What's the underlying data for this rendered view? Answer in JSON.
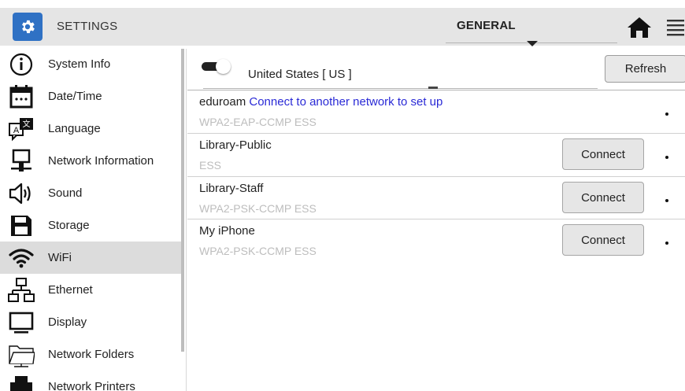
{
  "header": {
    "app_title": "SETTINGS",
    "section": "GENERAL",
    "app_icon": "gear-icon",
    "home_icon": "home-icon",
    "menu_icon": "hamburger-menu-icon",
    "accent_color": "#2f71c4"
  },
  "sidebar": {
    "items": [
      {
        "label": "System Info",
        "icon": "info-icon",
        "active": false
      },
      {
        "label": "Date/Time",
        "icon": "calendar-icon",
        "active": false
      },
      {
        "label": "Language",
        "icon": "language-icon",
        "active": false
      },
      {
        "label": "Network Information",
        "icon": "network-computer-icon",
        "active": false
      },
      {
        "label": "Sound",
        "icon": "speaker-icon",
        "active": false
      },
      {
        "label": "Storage",
        "icon": "floppy-disk-icon",
        "active": false
      },
      {
        "label": "WiFi",
        "icon": "wifi-icon",
        "active": true
      },
      {
        "label": "Ethernet",
        "icon": "ethernet-icon",
        "active": false
      },
      {
        "label": "Display",
        "icon": "monitor-icon",
        "active": false
      },
      {
        "label": "Network Folders",
        "icon": "folder-icon",
        "active": false
      },
      {
        "label": "Network Printers",
        "icon": "printer-icon",
        "active": false
      }
    ]
  },
  "wifi": {
    "enabled": true,
    "country": "United States [ US ]",
    "refresh_label": "Refresh",
    "networks": [
      {
        "name": "eduroam",
        "link": "Connect to another network to set up",
        "security": "WPA2-EAP-CCMP ESS",
        "button": ""
      },
      {
        "name": "Library-Public",
        "link": "",
        "security": "ESS",
        "button": "Connect"
      },
      {
        "name": "Library-Staff",
        "link": "",
        "security": "WPA2-PSK-CCMP ESS",
        "button": "Connect"
      },
      {
        "name": "My iPhone",
        "link": "",
        "security": "WPA2-PSK-CCMP ESS",
        "button": "Connect"
      }
    ]
  }
}
